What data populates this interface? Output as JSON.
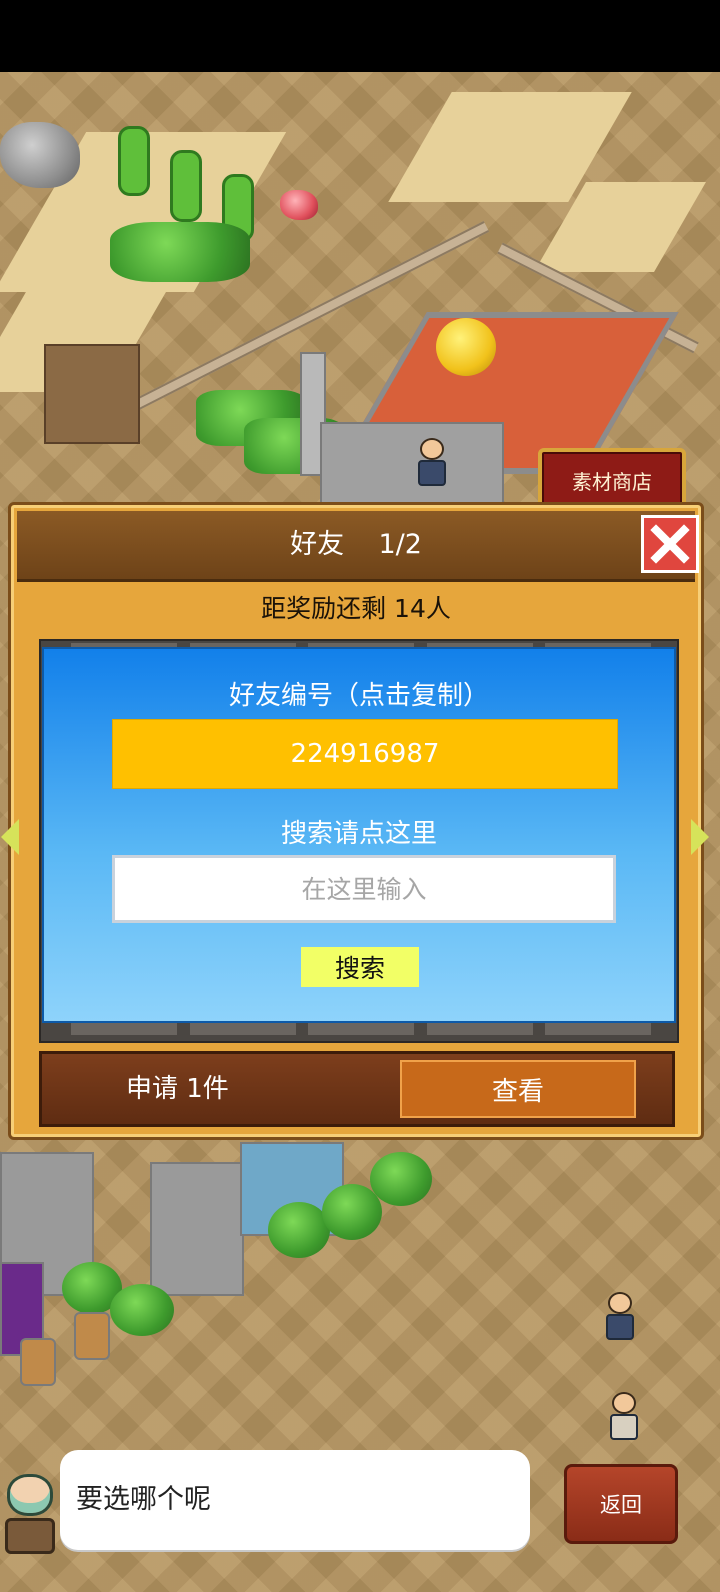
{
  "shop_sign": "素材商店",
  "dialog": {
    "title": "好友",
    "page": "1/2",
    "reward_remaining": "距奖励还剩 14人",
    "friend_code_label": "好友编号（点击复制）",
    "friend_code": "224916987",
    "search_label": "搜索请点这里",
    "search_placeholder": "在这里输入",
    "search_button": "搜索",
    "requests": "申请 1件",
    "view_button": "查看"
  },
  "chat": {
    "message": "要选哪个呢"
  },
  "back_button": "返回",
  "colors": {
    "friend_code_bg": "#ffc000",
    "search_button_bg": "#f2ff66",
    "close_button_bg": "#e0463e",
    "panel_gradient_top": "#1280ea"
  },
  "icons": [
    "close-icon",
    "arrow-left-icon",
    "arrow-right-icon"
  ]
}
